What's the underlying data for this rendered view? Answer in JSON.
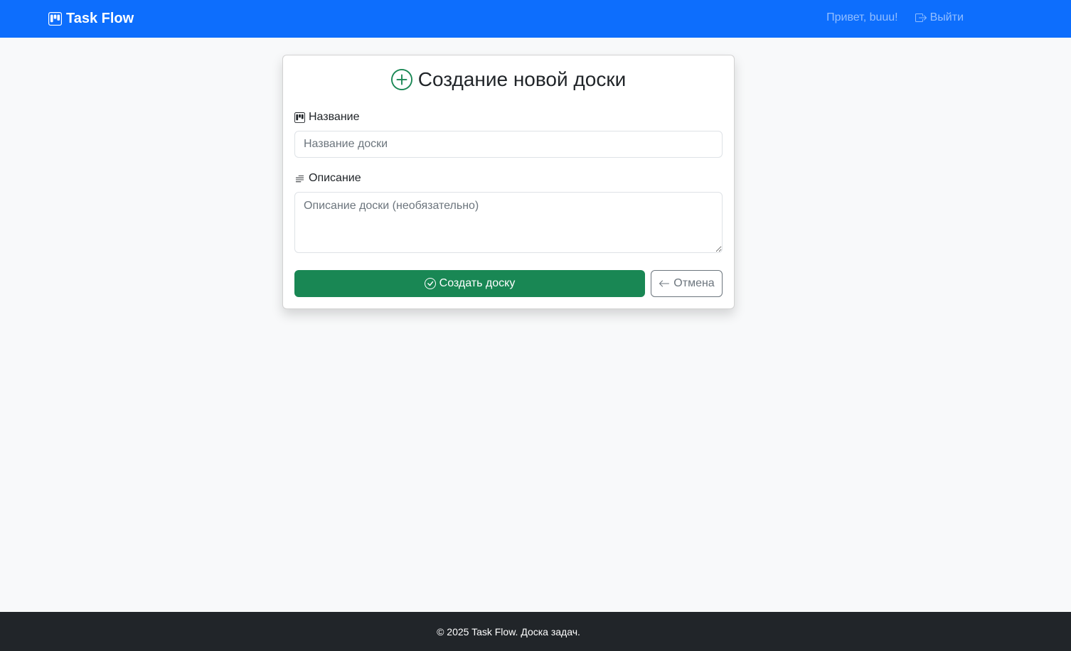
{
  "navbar": {
    "brand": "Task Flow",
    "greeting": "Привет, buuu!",
    "logout": "Выйти",
    "color": "#0d6efd"
  },
  "form": {
    "title": "Создание новой доски",
    "name_label": "Название",
    "name_placeholder": "Название доски",
    "description_label": "Описание",
    "description_placeholder": "Описание доски (необязательно)",
    "submit_label": "Создать доску",
    "cancel_label": "Отмена",
    "submit_color": "#198754"
  },
  "footer": {
    "text": "© 2025 Task Flow. Доска задач."
  },
  "icons": {
    "brand": "kanban-icon",
    "logout": "box-arrow-right-icon",
    "title": "plus-circle-icon",
    "name": "kanban-icon",
    "description": "text-lines-icon",
    "submit": "check-circle-icon",
    "cancel": "arrow-left-icon"
  }
}
